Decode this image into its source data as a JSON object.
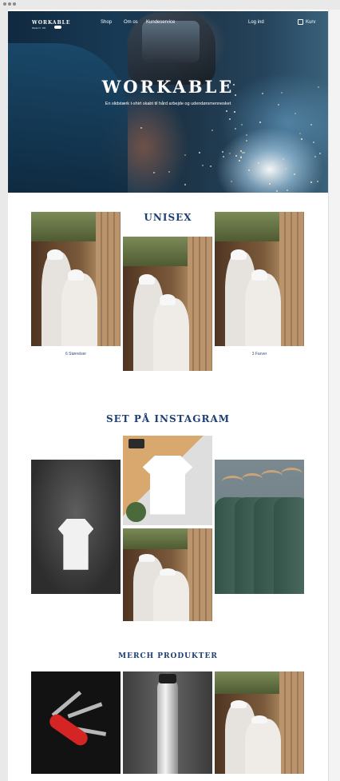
{
  "header": {
    "logo": "WORKABLE",
    "sub_label": "Mode N · DK",
    "nav": [
      "Shop",
      "Om os",
      "Kundeservice"
    ],
    "login": "Log ind",
    "cart": "Kurv"
  },
  "hero": {
    "title": "WORKABLE",
    "subtitle": "En slidstærk t-shirt skabt til hård arbejde og udendørsmennesket"
  },
  "unisex": {
    "title": "UNISEX",
    "captions": [
      "6 Størrelser",
      "3 Farver"
    ]
  },
  "instagram": {
    "title": "SET PÅ INSTAGRAM"
  },
  "merch": {
    "title": "MERCH PRODUKTER"
  },
  "colors": {
    "accent": "#1d3f73",
    "caption": "#2d4f7e",
    "background": "#ffffff"
  },
  "icons": [
    "cart-icon",
    "toggle-icon"
  ]
}
